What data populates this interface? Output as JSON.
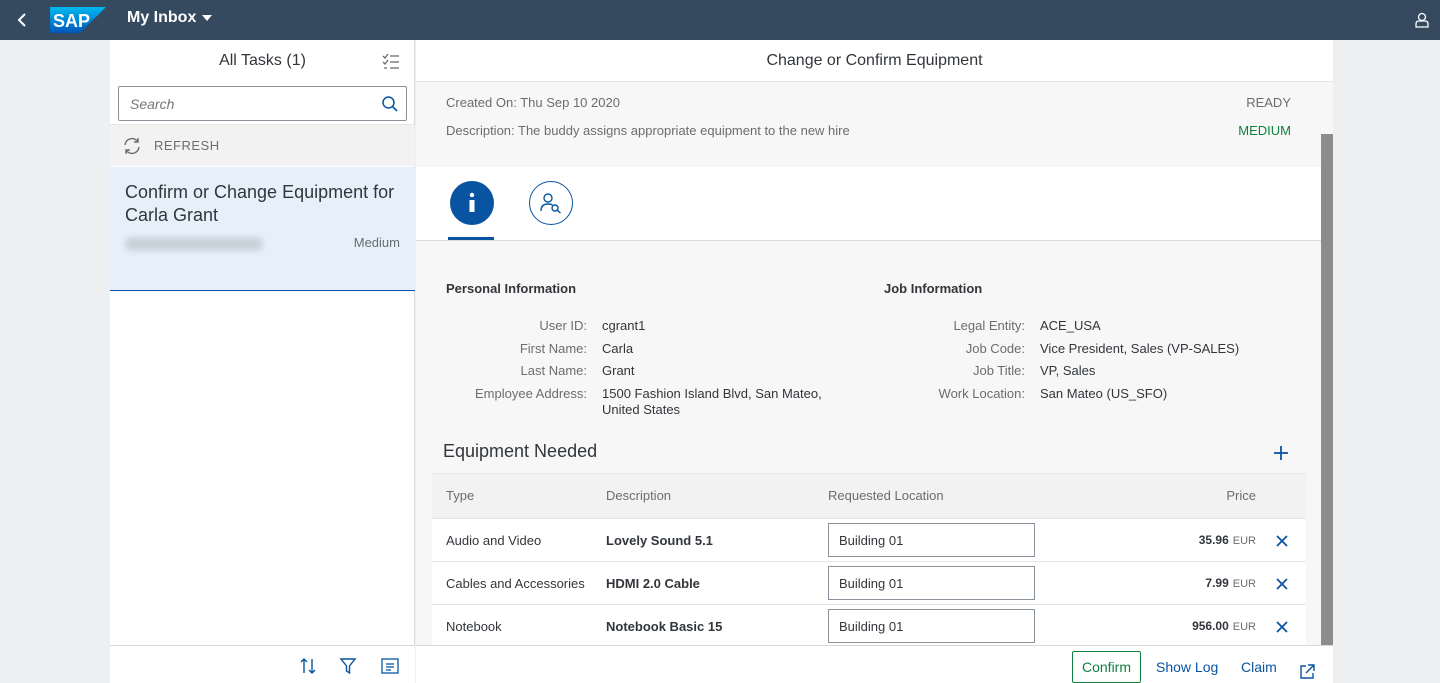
{
  "shell": {
    "logo_text": "SAP",
    "title": "My Inbox"
  },
  "master": {
    "title": "All Tasks (1)",
    "search_placeholder": "Search",
    "refresh_label": "REFRESH",
    "tasks": [
      {
        "title": "Confirm or Change Equipment for Carla Grant",
        "priority": "Medium"
      }
    ]
  },
  "detail": {
    "title": "Change or Confirm Equipment",
    "created_on": "Created On: Thu Sep 10 2020",
    "description": "Description: The buddy assigns appropriate equipment to the new hire",
    "status": "READY",
    "priority": "MEDIUM",
    "personal": {
      "title": "Personal Information",
      "fields": [
        {
          "label": "User ID:",
          "value": "cgrant1"
        },
        {
          "label": "First Name:",
          "value": "Carla"
        },
        {
          "label": "Last Name:",
          "value": "Grant"
        },
        {
          "label": "Employee Address:",
          "value": "1500 Fashion Island Blvd, San Mateo, United States"
        }
      ]
    },
    "job": {
      "title": "Job Information",
      "fields": [
        {
          "label": "Legal Entity:",
          "value": "ACE_USA"
        },
        {
          "label": "Job Code:",
          "value": "Vice President, Sales (VP-SALES)"
        },
        {
          "label": "Job Title:",
          "value": "VP, Sales"
        },
        {
          "label": "Work Location:",
          "value": "San Mateo (US_SFO)"
        }
      ]
    },
    "equipment": {
      "title": "Equipment Needed",
      "headers": {
        "type": "Type",
        "description": "Description",
        "location": "Requested Location",
        "price": "Price"
      },
      "rows": [
        {
          "type": "Audio and Video",
          "description": "Lovely Sound 5.1",
          "location": "Building 01",
          "price": "35.96",
          "currency": "EUR"
        },
        {
          "type": "Cables and Accessories",
          "description": "HDMI 2.0 Cable",
          "location": "Building 01",
          "price": "7.99",
          "currency": "EUR"
        },
        {
          "type": "Notebook",
          "description": "Notebook Basic 15",
          "location": "Building 01",
          "price": "956.00",
          "currency": "EUR"
        }
      ]
    },
    "footer": {
      "confirm": "Confirm",
      "show_log": "Show Log",
      "claim": "Claim"
    }
  },
  "colors": {
    "shell": "#354a5f",
    "brand_blue": "#0854a0",
    "positive": "#107e3e"
  }
}
